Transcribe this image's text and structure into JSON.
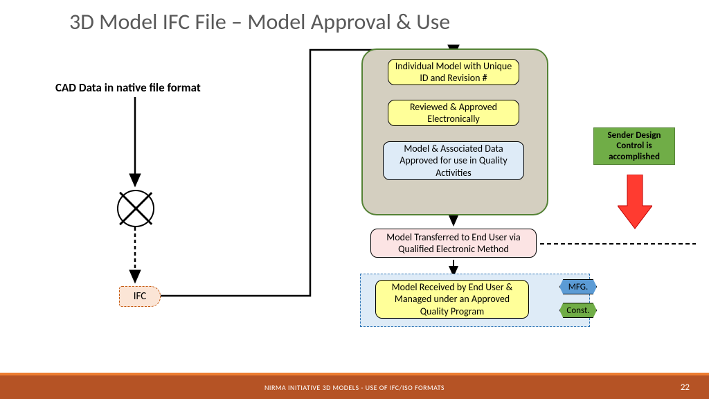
{
  "title": "3D Model IFC File – Model Approval & Use",
  "cad_label": "CAD Data in native file format",
  "ifc": "IFC",
  "boxes": {
    "b1": "Individual Model with Unique ID and Revision #",
    "b2": "Reviewed & Approved Electronically",
    "b3": "Model & Associated Data Approved for use in Quality Activities",
    "b4": "Model Transferred to End User via Qualified Electronic Method",
    "b5": "Model Received by End User & Managed under an Approved Quality Program"
  },
  "tags": {
    "mfg": "MFG.",
    "const": "Const."
  },
  "note": "Sender Design Control is accomplished",
  "footer": "NIRMA INITIATIVE  3D MODELS - USE OF IFC/ISO FORMATS",
  "page": "22"
}
